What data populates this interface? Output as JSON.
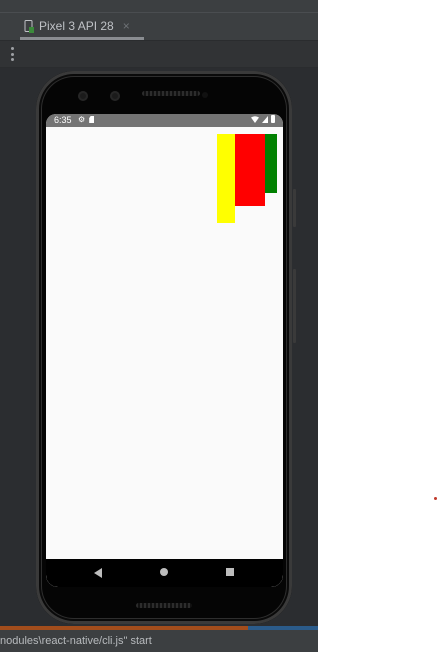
{
  "device_tab": {
    "label": "Pixel 3 API 28",
    "close_glyph": "×",
    "icon": "phone-icon"
  },
  "toolbar": {
    "more_icon": "more-vertical-icon"
  },
  "status_bar": {
    "time": "6:35",
    "left_icons": [
      "gear-icon",
      "sd-card-icon"
    ],
    "right_icons": [
      "wifi-icon",
      "signal-icon",
      "battery-icon"
    ]
  },
  "app": {
    "background": "#fafafa",
    "boxes": [
      {
        "name": "yellow-box",
        "color": "#ffff00"
      },
      {
        "name": "red-box",
        "color": "#ff0000"
      },
      {
        "name": "green-box",
        "color": "#008000"
      }
    ]
  },
  "nav_bar": {
    "buttons": [
      "back-button",
      "home-button",
      "recents-button"
    ]
  },
  "console": {
    "text": "nodules\\react-native/cli.js\" start"
  }
}
